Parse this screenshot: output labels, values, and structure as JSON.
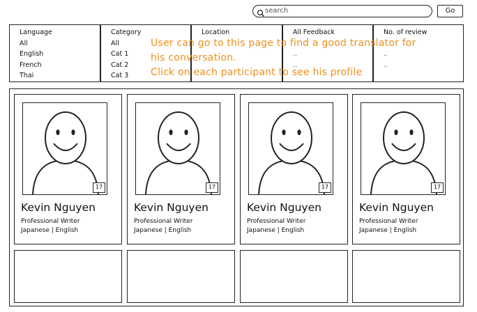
{
  "search": {
    "placeholder": "search",
    "go_label": "Go"
  },
  "filters": [
    {
      "header": "Language",
      "options": [
        "All",
        "English",
        "French",
        "Thai"
      ]
    },
    {
      "header": "Category",
      "options": [
        "All",
        "Cat 1",
        "Cat 2",
        "Cat 3"
      ]
    },
    {
      "header": "Location",
      "options": []
    },
    {
      "header": "All Feedback",
      "options": [
        "..",
        ".."
      ]
    },
    {
      "header": "No. of review",
      "options": [
        "..",
        ".."
      ]
    }
  ],
  "annotation": {
    "line1": "User can go to this page to find a good translator for",
    "line2": "his conversation.",
    "line3": "Click on each participant to see his profile"
  },
  "participants": [
    {
      "name": "Kevin Nguyen",
      "role": "Professional Writer",
      "languages": "Japanese |  English",
      "badge": "17"
    },
    {
      "name": "Kevin Nguyen",
      "role": "Professional Writer",
      "languages": "Japanese | English",
      "badge": "17"
    },
    {
      "name": "Kevin Nguyen",
      "role": "Professional Writer",
      "languages": "Japanese | English",
      "badge": "17"
    },
    {
      "name": "Kevin Nguyen",
      "role": "Professional Writer",
      "languages": "Japanese | English",
      "badge": "17"
    }
  ],
  "icons": {
    "search": "search-icon",
    "avatar": "smiley-avatar-icon"
  }
}
